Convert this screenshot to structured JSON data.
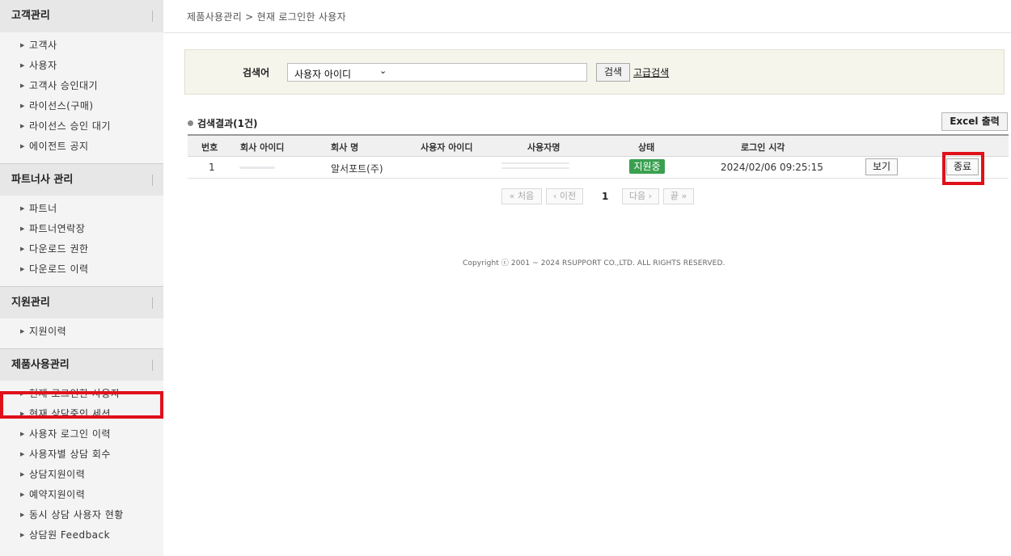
{
  "sidebar": {
    "sections": [
      {
        "title": "고객관리",
        "items": [
          "고객사",
          "사용자",
          "고객사 승인대기",
          "라이선스(구매)",
          "라이선스 승인 대기",
          "에이전트 공지"
        ]
      },
      {
        "title": "파트너사 관리",
        "items": [
          "파트너",
          "파트너연락장",
          "다운로드 권한",
          "다운로드 이력"
        ]
      },
      {
        "title": "지원관리",
        "items": [
          "지원이력"
        ]
      },
      {
        "title": "제품사용관리",
        "items": [
          "현재 로그인한 사용자",
          "현재 상담중인 세션",
          "사용자 로그인 이력",
          "사용자별 상담 회수",
          "상담지원이력",
          "예약지원이력",
          "동시 상담 사용자 현황",
          "상담원 Feedback"
        ]
      }
    ]
  },
  "breadcrumb": "제품사용관리 > 현재 로그인한 사용자",
  "search": {
    "label": "검색어",
    "select_value": "사용자 아이디",
    "button": "검색",
    "advanced": "고급검색"
  },
  "results": {
    "title": "검색결과(1건)",
    "excel_button": "Excel 출력",
    "columns": [
      "번호",
      "회사 아이디",
      "회사 명",
      "사용자 아이디",
      "사용자명",
      "상태",
      "로그인 시각"
    ],
    "rows": [
      {
        "no": "1",
        "company_name": "알서포트(주)",
        "status": "지원중",
        "login_time": "2024/02/06 09:25:15",
        "view": "보기",
        "end": "종료"
      }
    ]
  },
  "pager": {
    "first": "처음",
    "prev": "이전",
    "current": "1",
    "next": "다음",
    "last": "끝"
  },
  "footer": {
    "copyright": "Copyright ⓒ 2001 ~ 2024 RSUPPORT CO.,LTD. ALL RIGHTS RESERVED."
  },
  "colors": {
    "highlight": "#e0101a",
    "status_badge": "#3aa050",
    "search_panel": "#f6f5ec"
  }
}
